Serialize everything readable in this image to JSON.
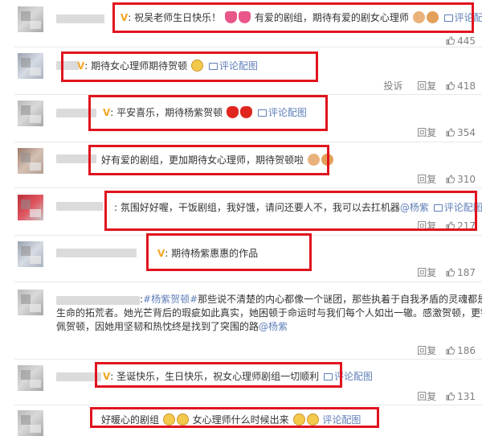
{
  "comments": [
    {
      "text": "祝吴老师生日快乐！",
      "text2": "有爱的剧组，期待有爱的剧女心理师",
      "pic_link": "评论配图",
      "likes": "445"
    },
    {
      "text": "期待女心理师期待贺顿",
      "pic_link": "评论配图",
      "report": "投诉",
      "reply": "回复",
      "likes": "418"
    },
    {
      "text": "平安喜乐，期待杨紫贺顿",
      "pic_link": "评论配图",
      "reply": "回复",
      "likes": "354"
    },
    {
      "text": "好有爱的剧组，更加期待女心理师，期待贺顿啦",
      "reply": "回复",
      "likes": "310"
    },
    {
      "text": "氛围好好喔，干饭剧组，我好饿，请问还要人不，我可以去扛机器",
      "mention": "@杨紫",
      "pic_link": "评论配图",
      "reply": "回复",
      "likes": "217"
    },
    {
      "text": "期待杨紫惠惠的作品",
      "reply": "回复",
      "likes": "187"
    },
    {
      "hashtag": "#杨紫贺顿#",
      "text": "那些说不清楚的内心都像一个谜团，那些执着于自我矛盾的灵魂都是生命的拓荒者。她光芒背后的瑕疵如此真实，她困顿于命运时与我们每个人如出一辙。感激贺顿，更钦佩贺顿，因她用坚韧和热忱终是找到了突围的路",
      "mention": "@杨紫",
      "reply": "回复",
      "likes": "186"
    },
    {
      "text": "圣诞快乐，生日快乐，祝女心理师剧组一切顺利",
      "pic_link": "评论配图",
      "reply": "回复",
      "likes": "131"
    },
    {
      "text": "好暖心的剧组",
      "text2": "女心理师什么时候出来",
      "text3": "评论配图"
    }
  ],
  "badge": "V",
  "colors": {
    "highlight": "#e0141e",
    "link": "#5f7fb8",
    "badge": "#f5a623"
  }
}
